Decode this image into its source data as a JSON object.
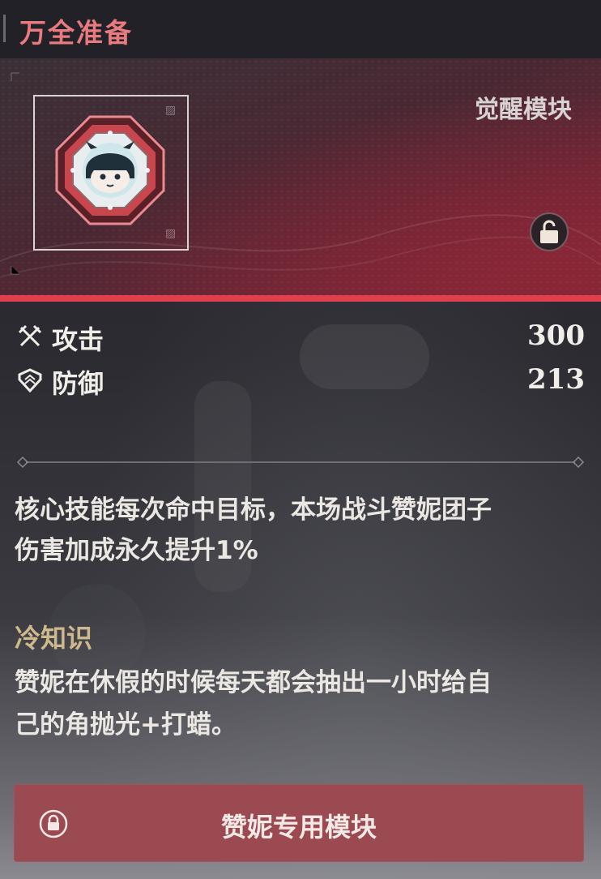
{
  "header": {
    "title": "万全准备"
  },
  "hero": {
    "module_type": "觉醒模块",
    "module_icon": "zani-chibi-module-icon",
    "lock_state": "unlocked"
  },
  "stats": [
    {
      "icon": "crossed-swords-icon",
      "name": "攻击",
      "value": "300"
    },
    {
      "icon": "shield-icon",
      "name": "防御",
      "value": "213"
    }
  ],
  "description": {
    "line1": "核心技能每次命中目标，本场战斗赞妮团子",
    "line2": "伤害加成永久提升1%"
  },
  "trivia": {
    "title": "冷知识",
    "line1": "赞妮在休假的时候每天都会抽出一小时给自",
    "line2": "己的角抛光+打蜡。"
  },
  "bottom_button": {
    "label": "赞妮专用模块",
    "icon": "lock-icon"
  },
  "colors": {
    "title_red": "#e87a80",
    "accent_strip": "#e0404e",
    "trivia_gold": "#cdb98b",
    "button_bg": "#9c4a52"
  }
}
